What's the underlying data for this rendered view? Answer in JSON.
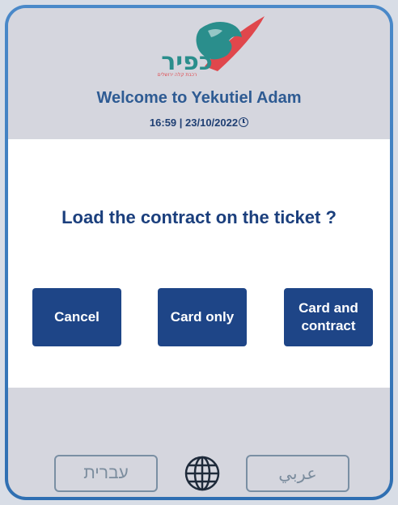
{
  "header": {
    "logo_text": "כפיר",
    "logo_subtext": "רכבת קלה ירושלים",
    "welcome": "Welcome to Yekutiel Adam",
    "datetime": "16:59 | 23/10/2022"
  },
  "dialog": {
    "question": "Load the contract on the ticket ?",
    "buttons": {
      "cancel": "Cancel",
      "card_only": "Card only",
      "card_and_contract": "Card and contract"
    }
  },
  "footer": {
    "hebrew": "עברית",
    "arabic": "عربي",
    "globe_icon": "globe-icon"
  },
  "colors": {
    "primary": "#1e4587",
    "frame": "#3d7ec1",
    "header_bg": "#d5d6de",
    "logo_red": "#e0474c",
    "logo_teal": "#2a8e8c"
  }
}
